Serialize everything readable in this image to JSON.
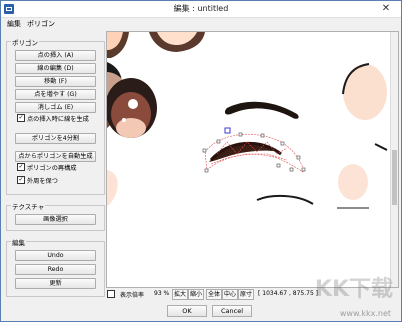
{
  "window": {
    "title": "編集 : untitled",
    "close": "✕"
  },
  "menu": [
    "編集",
    "ポリゴン"
  ],
  "polygon_group": {
    "title": "ポリゴン",
    "buttons": [
      "点の挿入 (A)",
      "線の編集 (D)",
      "移動 (F)",
      "点を増やす (G)",
      "消しゴム (E)"
    ],
    "check_insert": "点の挿入時に線を生成",
    "split_button": "ポリゴンを4分割",
    "auto_button": "点からポリゴンを自動生成",
    "check_rebuild": "ポリゴンの再構成",
    "check_outer": "外周を保つ"
  },
  "texture_group": {
    "title": "テクスチャ",
    "select_button": "画像選択"
  },
  "edit_group": {
    "title": "編集",
    "undo": "Undo",
    "redo": "Redo",
    "update": "更新"
  },
  "status": {
    "display_magnification": "表示倍率",
    "zoom_value": "93 %",
    "zoom_in": "拡大",
    "zoom_out": "縮小",
    "whole": "全体",
    "center": "中心",
    "original": "原寸",
    "coords": "[ 1034.67 , 875.75 ]"
  },
  "footer": {
    "ok": "OK",
    "cancel": "Cancel"
  },
  "watermark": {
    "text": "KK下载",
    "url": "www.kkx.net"
  },
  "colors": {
    "accent": "#2b5fa8",
    "polygon": "#e05050",
    "selection": "#3a3ad0"
  }
}
